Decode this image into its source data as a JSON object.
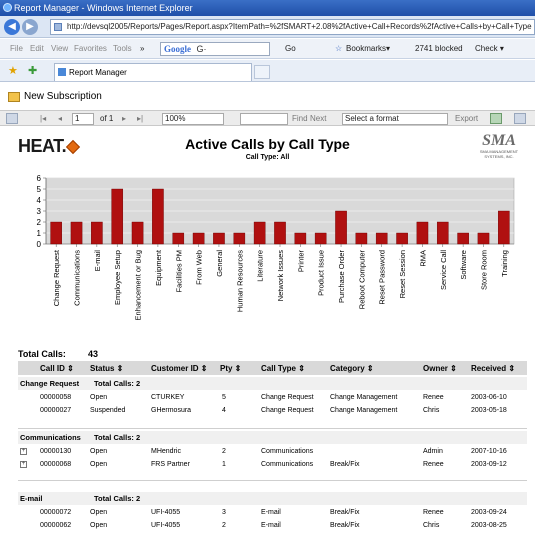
{
  "window": {
    "title": "Report Manager - Windows Internet Explorer"
  },
  "addressbar": {
    "url": "http://devsql2005/Reports/Pages/Report.aspx?ItemPath=%2fSMART+2.08%2fActive+Call+Records%2fActive+Calls+by+Call+Type"
  },
  "menubar": {
    "file": "File",
    "edit": "Edit",
    "view": "View",
    "favorites": "Favorites",
    "tools": "Tools",
    "more": "»",
    "search_brand": "Google",
    "search_value": "G·",
    "go": "Go",
    "bookmarks": "Bookmarks▾",
    "blocked": "2741 blocked",
    "check": "Check ▾"
  },
  "tabs": [
    {
      "label": "Report Manager"
    }
  ],
  "subscription": {
    "label": "New Subscription"
  },
  "report_toolbar": {
    "page_of": "of 1",
    "zoom": "100%",
    "find": "Find",
    "next": "Next",
    "format_placeholder": "Select a format",
    "export": "Export"
  },
  "report": {
    "logo": "HEAT.",
    "title": "Active Calls by Call Type",
    "subtitle": "Call Type: All",
    "sma_logo": "SMA",
    "sma_tagline": "SMA MANAGEMENT SYSTEMS, INC."
  },
  "chart_data": {
    "type": "bar",
    "categories": [
      "Change Request",
      "Communications",
      "E-mail",
      "Employee Setup",
      "Enhancement or Bug",
      "Equipment",
      "Facilities PM",
      "From Web",
      "General",
      "Human Resources",
      "Literature",
      "Network Issues",
      "Printer",
      "Product Issue",
      "Purchase Order",
      "Reboot Computer",
      "Reset Password",
      "Reset Session",
      "RMA",
      "Service Call",
      "Software",
      "Store Room",
      "Training"
    ],
    "values": [
      2,
      2,
      2,
      5,
      2,
      5,
      1,
      1,
      1,
      1,
      2,
      2,
      1,
      1,
      3,
      1,
      1,
      1,
      2,
      2,
      1,
      1,
      3
    ],
    "yticks": [
      "0",
      "1",
      "2",
      "3",
      "4",
      "5",
      "6"
    ],
    "ylim": [
      0,
      6
    ],
    "grid": true,
    "bar_color": "#b01010"
  },
  "totals": {
    "label": "Total Calls:",
    "value": "43"
  },
  "table": {
    "headers": [
      "Call ID ⇕",
      "Status ⇕",
      "Customer ID ⇕",
      "Pty ⇕",
      "Call Type ⇕",
      "Category ⇕",
      "Owner ⇕",
      "Received ⇕"
    ],
    "group_label": "Total Calls:",
    "groups": [
      {
        "name": "Change Request",
        "total": "2",
        "rows": [
          [
            "00000058",
            "Open",
            "CTURKEY",
            "5",
            "Change Request",
            "Change Management",
            "Renee",
            "2003-06-10"
          ],
          [
            "00000027",
            "Suspended",
            "GHermosura",
            "4",
            "Change Request",
            "Change Management",
            "Chris",
            "2003-05-18"
          ]
        ]
      },
      {
        "name": "Communications",
        "total": "2",
        "rows": [
          [
            "00000130",
            "Open",
            "MHendric",
            "2",
            "Communications",
            "",
            "Admin",
            "2007-10-16"
          ],
          [
            "00000068",
            "Open",
            "FRS Partner",
            "1",
            "Communications",
            "Break/Fix",
            "Renee",
            "2003-09-12"
          ]
        ]
      },
      {
        "name": "E-mail",
        "total": "2",
        "rows": [
          [
            "00000072",
            "Open",
            "UFI-4055",
            "3",
            "E-mail",
            "Break/Fix",
            "Renee",
            "2003-09-24"
          ],
          [
            "00000062",
            "Open",
            "UFI-4055",
            "2",
            "E-mail",
            "Break/Fix",
            "Chris",
            "2003-08-25"
          ]
        ]
      }
    ]
  }
}
